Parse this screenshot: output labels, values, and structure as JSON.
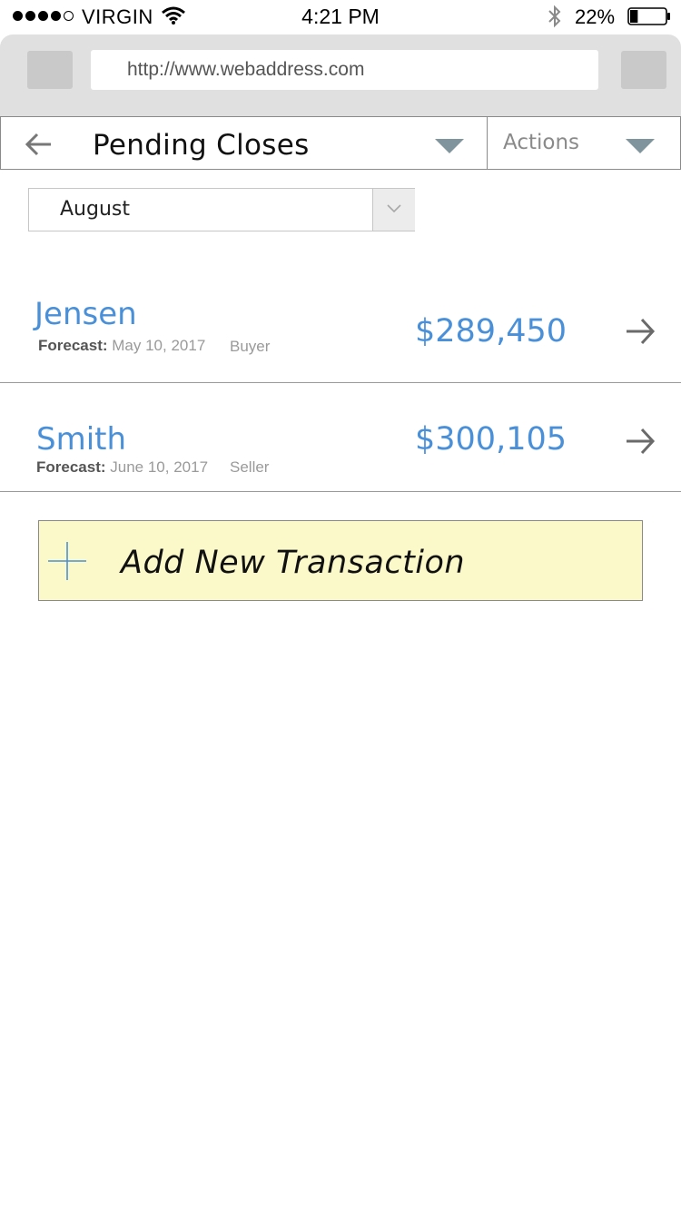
{
  "status_bar": {
    "carrier": "VIRGIN",
    "signal_bars_filled": 4,
    "signal_bars_total": 5,
    "time": "4:21 PM",
    "battery_percent": "22%",
    "battery_level": 0.22
  },
  "browser": {
    "url": "http://www.webaddress.com"
  },
  "header": {
    "title": "Pending Closes",
    "actions_label": "Actions"
  },
  "filter": {
    "month": "August"
  },
  "transactions": [
    {
      "name": "Jensen",
      "forecast_label": "Forecast:",
      "forecast_date": "May 10, 2017",
      "role": "Buyer",
      "amount": "$289,450"
    },
    {
      "name": "Smith",
      "forecast_label": "Forecast:",
      "forecast_date": "June 10, 2017",
      "role": "Seller",
      "amount": "$300,105"
    }
  ],
  "add_transaction": {
    "label": "Add New Transaction"
  },
  "colors": {
    "accent_blue": "#4a90d9",
    "add_button_bg": "#fbf9c9",
    "caret_gray": "#7f949c"
  },
  "icons": {
    "back": "arrow-left-icon",
    "dropdown": "caret-down-icon",
    "row_arrow": "arrow-right-icon",
    "add": "plus-icon",
    "wifi": "wifi-icon",
    "bluetooth": "bluetooth-icon",
    "battery": "battery-icon"
  }
}
